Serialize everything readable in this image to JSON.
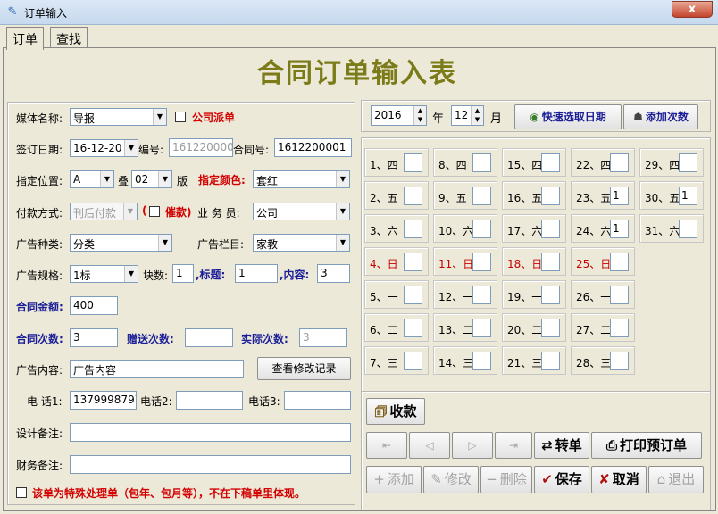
{
  "window": {
    "title": "订单输入",
    "close_label": "x"
  },
  "tabs": [
    {
      "label": "订单"
    },
    {
      "label": "查找"
    }
  ],
  "header": {
    "title": "合同订单输入表"
  },
  "form": {
    "media_label": "媒体名称:",
    "media_value": "导报",
    "company_dispatch_label": "公司派单",
    "sign_date_label": "签订日期:",
    "sign_date_value": "16-12-20",
    "number_label": "编号:",
    "number_value": "1612200001",
    "contract_no_label": "合同号:",
    "contract_no_value": "1612200001",
    "position_label": "指定位置:",
    "position_value": "A",
    "stack_label": "叠",
    "stack_value": "02",
    "edition_label": "版",
    "color_label": "指定颜色:",
    "color_value": "套红",
    "pay_method_label": "付款方式:",
    "pay_method_value": "刊后付款",
    "urge_paren_open": "(",
    "urge_label": "催款)",
    "salesperson_label": "业 务 员:",
    "salesperson_value": "公司",
    "ad_type_label": "广告种类:",
    "ad_type_value": "分类",
    "ad_column_label": "广告栏目:",
    "ad_column_value": "家教",
    "ad_spec_label": "广告规格:",
    "ad_spec_value": "1标",
    "blocks_label": "块数:",
    "blocks_value": "1",
    "title_label": ",标题:",
    "title_value": "1",
    "content_label": ",内容:",
    "content_value": "3",
    "amount_label": "合同金额:",
    "amount_value": "400",
    "times_label": "合同次数:",
    "times_value": "3",
    "gift_times_label": "赠送次数:",
    "gift_times_value": "",
    "actual_times_label": "实际次数:",
    "actual_times_value": "3",
    "ad_content_label": "广告内容:",
    "ad_content_value": "广告内容",
    "view_log_button": "查看修改记录",
    "phone1_label": "电 话1:",
    "phone1_value": "1379998797",
    "phone2_label": "电话2:",
    "phone2_value": "",
    "phone3_label": "电话3:",
    "phone3_value": "",
    "design_note_label": "设计备注:",
    "design_note_value": "",
    "finance_note_label": "财务备注:",
    "finance_note_value": "",
    "special_note": "该单为特殊处理单（包年、包月等），不在下稿单里体现。"
  },
  "date_picker": {
    "year_value": "2016",
    "year_label": "年",
    "month_value": "12",
    "month_label": "月",
    "quick_select_button": "快速选取日期",
    "add_times_button": "添加次数"
  },
  "calendar": [
    {
      "label": "1、四",
      "value": ""
    },
    {
      "label": "8、四",
      "value": ""
    },
    {
      "label": "15、四",
      "value": ""
    },
    {
      "label": "22、四",
      "value": ""
    },
    {
      "label": "29、四",
      "value": ""
    },
    {
      "label": "2、五",
      "value": ""
    },
    {
      "label": "9、五",
      "value": ""
    },
    {
      "label": "16、五",
      "value": ""
    },
    {
      "label": "23、五",
      "value": "1"
    },
    {
      "label": "30、五",
      "value": "1"
    },
    {
      "label": "3、六",
      "value": ""
    },
    {
      "label": "10、六",
      "value": ""
    },
    {
      "label": "17、六",
      "value": ""
    },
    {
      "label": "24、六",
      "value": "1"
    },
    {
      "label": "31、六",
      "value": ""
    },
    {
      "label": "4、日",
      "value": ""
    },
    {
      "label": "11、日",
      "value": ""
    },
    {
      "label": "18、日",
      "value": ""
    },
    {
      "label": "25、日",
      "value": ""
    },
    {
      "label": "5、一",
      "value": ""
    },
    {
      "label": "12、一",
      "value": ""
    },
    {
      "label": "19、一",
      "value": ""
    },
    {
      "label": "26、一",
      "value": ""
    },
    {
      "label": "6、二",
      "value": ""
    },
    {
      "label": "13、二",
      "value": ""
    },
    {
      "label": "20、二",
      "value": ""
    },
    {
      "label": "27、二",
      "value": ""
    },
    {
      "label": "7、三",
      "value": ""
    },
    {
      "label": "14、三",
      "value": ""
    },
    {
      "label": "21、三",
      "value": ""
    },
    {
      "label": "28、三",
      "value": ""
    }
  ],
  "actions": {
    "receive_button": "收款",
    "transfer_button": "转单",
    "print_button": "打印预订单",
    "add_button": "添加",
    "edit_button": "修改",
    "delete_button": "删除",
    "save_button": "保存",
    "cancel_button": "取消",
    "exit_button": "退出"
  },
  "colors": {
    "title": "#7b7b19",
    "red_label": "#d20000",
    "blue_label": "#1c1f97",
    "sunday": "#c80000"
  }
}
